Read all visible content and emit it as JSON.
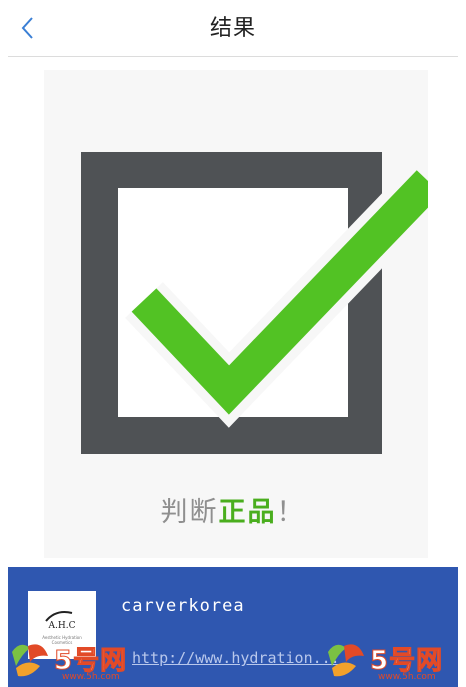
{
  "header": {
    "back_icon": "chevron-left-icon",
    "title": "结果"
  },
  "result": {
    "icon": "green-checkmark-icon",
    "verdict_prefix": "判断",
    "verdict_highlight": "正品",
    "verdict_suffix": "！",
    "colors": {
      "check": "#52c224",
      "box": "#4f5255",
      "highlight": "#4aae1e"
    }
  },
  "product": {
    "logo_text": "A.H.C",
    "logo_tagline": "Aesthetic Hydration Cosmetics",
    "name": "carverkorea",
    "url": "http://www.hydration...",
    "bar_color": "#2f57b0"
  },
  "watermark": {
    "brand": "5号网",
    "url": "www.5h.com"
  }
}
